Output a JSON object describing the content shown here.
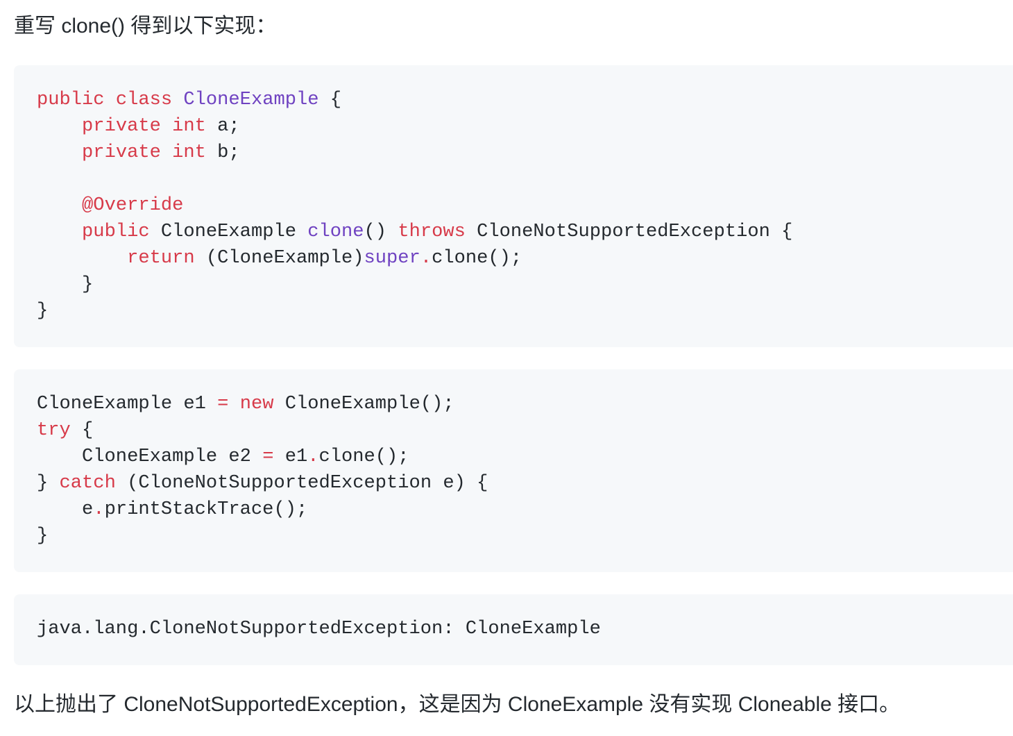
{
  "intro_text": "重写 clone() 得到以下实现：",
  "outro_text": "以上抛出了 CloneNotSupportedException，这是因为 CloneExample 没有实现 Cloneable 接口。",
  "colors": {
    "keyword": "#d73a49",
    "type_name": "#6f42c1",
    "plain": "#24292e",
    "code_background": "#f6f8fa"
  },
  "code_blocks": [
    {
      "language": "java",
      "lines": [
        [
          {
            "t": "public",
            "c": "kw"
          },
          {
            "t": " "
          },
          {
            "t": "class",
            "c": "kw"
          },
          {
            "t": " "
          },
          {
            "t": "CloneExample",
            "c": "ty"
          },
          {
            "t": " {"
          }
        ],
        [
          {
            "t": "    "
          },
          {
            "t": "private",
            "c": "kw"
          },
          {
            "t": " "
          },
          {
            "t": "int",
            "c": "kw"
          },
          {
            "t": " a;"
          }
        ],
        [
          {
            "t": "    "
          },
          {
            "t": "private",
            "c": "kw"
          },
          {
            "t": " "
          },
          {
            "t": "int",
            "c": "kw"
          },
          {
            "t": " b;"
          }
        ],
        [],
        [
          {
            "t": "    "
          },
          {
            "t": "@Override",
            "c": "an"
          }
        ],
        [
          {
            "t": "    "
          },
          {
            "t": "public",
            "c": "kw"
          },
          {
            "t": " CloneExample "
          },
          {
            "t": "clone",
            "c": "ty"
          },
          {
            "t": "() "
          },
          {
            "t": "throws",
            "c": "kw"
          },
          {
            "t": " CloneNotSupportedException {"
          }
        ],
        [
          {
            "t": "        "
          },
          {
            "t": "return",
            "c": "kw"
          },
          {
            "t": " (CloneExample)"
          },
          {
            "t": "super",
            "c": "ty"
          },
          {
            "t": ".",
            "c": "kw"
          },
          {
            "t": "clone();"
          }
        ],
        [
          {
            "t": "    }"
          }
        ],
        [
          {
            "t": "}"
          }
        ]
      ]
    },
    {
      "language": "java",
      "lines": [
        [
          {
            "t": "CloneExample e1 "
          },
          {
            "t": "=",
            "c": "kw"
          },
          {
            "t": " "
          },
          {
            "t": "new",
            "c": "kw"
          },
          {
            "t": " CloneExample();"
          }
        ],
        [
          {
            "t": "try",
            "c": "kw"
          },
          {
            "t": " {"
          }
        ],
        [
          {
            "t": "    CloneExample e2 "
          },
          {
            "t": "=",
            "c": "kw"
          },
          {
            "t": " e1"
          },
          {
            "t": ".",
            "c": "kw"
          },
          {
            "t": "clone();"
          }
        ],
        [
          {
            "t": "} "
          },
          {
            "t": "catch",
            "c": "kw"
          },
          {
            "t": " (CloneNotSupportedException e) {"
          }
        ],
        [
          {
            "t": "    e"
          },
          {
            "t": ".",
            "c": "kw"
          },
          {
            "t": "printStackTrace();"
          }
        ],
        [
          {
            "t": "}"
          }
        ]
      ]
    },
    {
      "language": "text",
      "lines": [
        [
          {
            "t": "java.lang.CloneNotSupportedException: CloneExample"
          }
        ]
      ]
    }
  ]
}
